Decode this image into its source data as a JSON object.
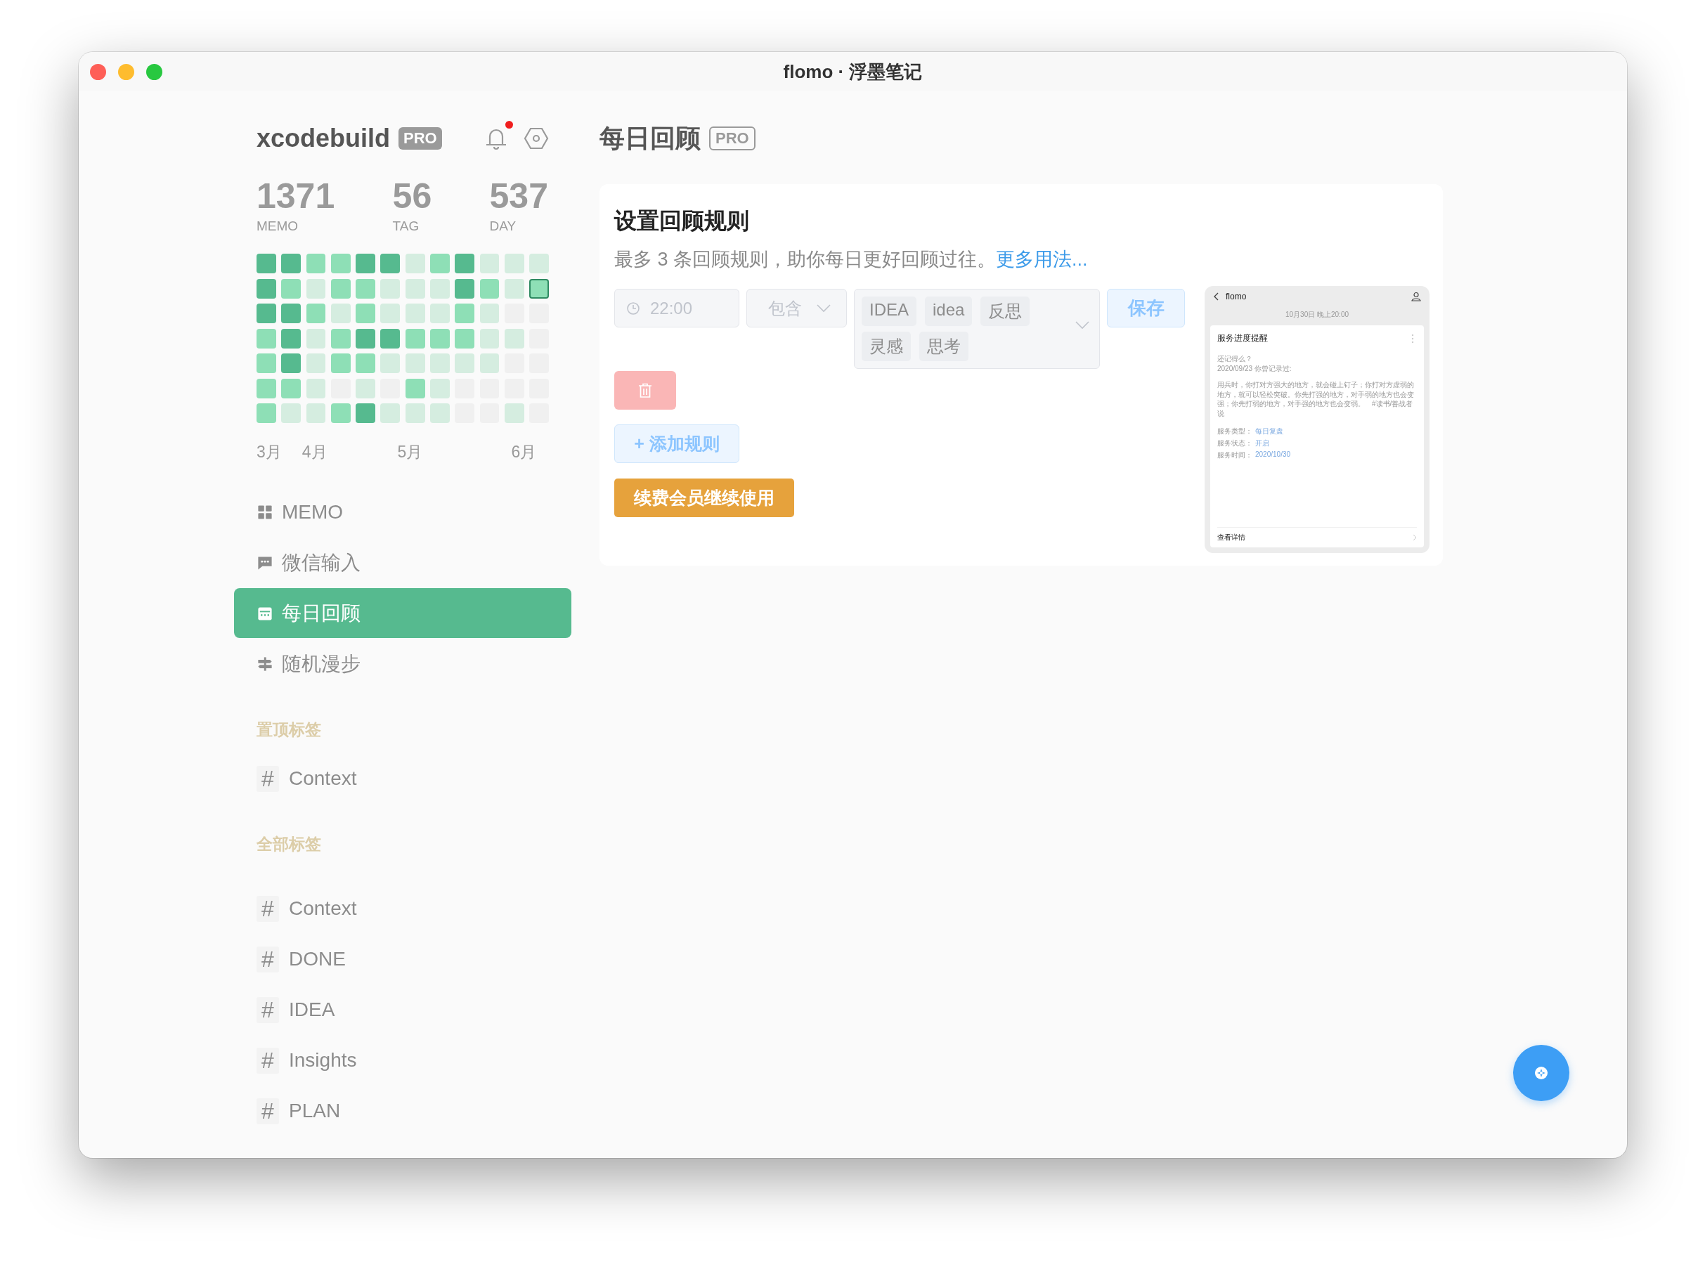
{
  "window": {
    "title": "flomo · 浮墨笔记"
  },
  "sidebar": {
    "user": {
      "name": "xcodebuild",
      "badge": "PRO",
      "unread": true
    },
    "stats": [
      {
        "value": "1371",
        "label": "MEMO"
      },
      {
        "value": "56",
        "label": "TAG"
      },
      {
        "value": "537",
        "label": "DAY"
      }
    ],
    "heatmap": {
      "rows": [
        {
          "cells": [
            {
              "color": "#56ba8f",
              "outlined": false
            },
            {
              "color": "#56ba8f",
              "outlined": false
            },
            {
              "color": "#8edfb6",
              "outlined": false
            },
            {
              "color": "#8edfb6",
              "outlined": false
            },
            {
              "color": "#56ba8f",
              "outlined": false
            },
            {
              "color": "#56ba8f",
              "outlined": false
            },
            {
              "color": "#d5ede0",
              "outlined": false
            },
            {
              "color": "#8edfb6",
              "outlined": false
            },
            {
              "color": "#56ba8f",
              "outlined": false
            },
            {
              "color": "#d5ede0",
              "outlined": false
            },
            {
              "color": "#d5ede0",
              "outlined": false
            },
            {
              "color": "#d5ede0",
              "outlined": false
            }
          ]
        },
        {
          "cells": [
            {
              "color": "#56ba8f",
              "outlined": false
            },
            {
              "color": "#8edfb6",
              "outlined": false
            },
            {
              "color": "#d5ede0",
              "outlined": false
            },
            {
              "color": "#8edfb6",
              "outlined": false
            },
            {
              "color": "#8edfb6",
              "outlined": false
            },
            {
              "color": "#d5ede0",
              "outlined": false
            },
            {
              "color": "#d5ede0",
              "outlined": false
            },
            {
              "color": "#d5ede0",
              "outlined": false
            },
            {
              "color": "#56ba8f",
              "outlined": false
            },
            {
              "color": "#8edfb6",
              "outlined": false
            },
            {
              "color": "#d5ede0",
              "outlined": false
            },
            {
              "color": "#8edfb6",
              "outlined": true
            }
          ]
        },
        {
          "cells": [
            {
              "color": "#56ba8f",
              "outlined": false
            },
            {
              "color": "#56ba8f",
              "outlined": false
            },
            {
              "color": "#8edfb6",
              "outlined": false
            },
            {
              "color": "#d5ede0",
              "outlined": false
            },
            {
              "color": "#8edfb6",
              "outlined": false
            },
            {
              "color": "#d5ede0",
              "outlined": false
            },
            {
              "color": "#d5ede0",
              "outlined": false
            },
            {
              "color": "#d5ede0",
              "outlined": false
            },
            {
              "color": "#8edfb6",
              "outlined": false
            },
            {
              "color": "#d5ede0",
              "outlined": false
            },
            {
              "color": "#f0f0f0",
              "outlined": false
            },
            {
              "color": "#f0f0f0",
              "outlined": false
            }
          ]
        },
        {
          "cells": [
            {
              "color": "#8edfb6",
              "outlined": false
            },
            {
              "color": "#56ba8f",
              "outlined": false
            },
            {
              "color": "#d5ede0",
              "outlined": false
            },
            {
              "color": "#8edfb6",
              "outlined": false
            },
            {
              "color": "#56ba8f",
              "outlined": false
            },
            {
              "color": "#56ba8f",
              "outlined": false
            },
            {
              "color": "#8edfb6",
              "outlined": false
            },
            {
              "color": "#8edfb6",
              "outlined": false
            },
            {
              "color": "#8edfb6",
              "outlined": false
            },
            {
              "color": "#d5ede0",
              "outlined": false
            },
            {
              "color": "#d5ede0",
              "outlined": false
            },
            {
              "color": "#f0f0f0",
              "outlined": false
            }
          ]
        },
        {
          "cells": [
            {
              "color": "#8edfb6",
              "outlined": false
            },
            {
              "color": "#56ba8f",
              "outlined": false
            },
            {
              "color": "#d5ede0",
              "outlined": false
            },
            {
              "color": "#8edfb6",
              "outlined": false
            },
            {
              "color": "#8edfb6",
              "outlined": false
            },
            {
              "color": "#d5ede0",
              "outlined": false
            },
            {
              "color": "#d5ede0",
              "outlined": false
            },
            {
              "color": "#d5ede0",
              "outlined": false
            },
            {
              "color": "#d5ede0",
              "outlined": false
            },
            {
              "color": "#d5ede0",
              "outlined": false
            },
            {
              "color": "#f0f0f0",
              "outlined": false
            },
            {
              "color": "#f0f0f0",
              "outlined": false
            }
          ]
        },
        {
          "cells": [
            {
              "color": "#8edfb6",
              "outlined": false
            },
            {
              "color": "#8edfb6",
              "outlined": false
            },
            {
              "color": "#d5ede0",
              "outlined": false
            },
            {
              "color": "#f0f0f0",
              "outlined": false
            },
            {
              "color": "#d5ede0",
              "outlined": false
            },
            {
              "color": "#f0f0f0",
              "outlined": false
            },
            {
              "color": "#8edfb6",
              "outlined": false
            },
            {
              "color": "#d5ede0",
              "outlined": false
            },
            {
              "color": "#f0f0f0",
              "outlined": false
            },
            {
              "color": "#f0f0f0",
              "outlined": false
            },
            {
              "color": "#f0f0f0",
              "outlined": false
            },
            {
              "color": "#f0f0f0",
              "outlined": false
            }
          ]
        },
        {
          "cells": [
            {
              "color": "#8edfb6",
              "outlined": false
            },
            {
              "color": "#d5ede0",
              "outlined": false
            },
            {
              "color": "#d5ede0",
              "outlined": false
            },
            {
              "color": "#8edfb6",
              "outlined": false
            },
            {
              "color": "#56ba8f",
              "outlined": false
            },
            {
              "color": "#d5ede0",
              "outlined": false
            },
            {
              "color": "#d5ede0",
              "outlined": false
            },
            {
              "color": "#d5ede0",
              "outlined": false
            },
            {
              "color": "#f0f0f0",
              "outlined": false
            },
            {
              "color": "#f0f0f0",
              "outlined": false
            },
            {
              "color": "#d5ede0",
              "outlined": false
            },
            {
              "color": "#f0f0f0",
              "outlined": false
            }
          ]
        }
      ],
      "months": [
        "3月",
        "4月",
        "5月",
        "6月"
      ]
    },
    "nav": [
      {
        "kind": "grid",
        "label": "MEMO",
        "selected": false
      },
      {
        "kind": "chat",
        "label": "微信输入",
        "selected": false
      },
      {
        "kind": "calendar",
        "label": "每日回顾",
        "selected": true
      },
      {
        "kind": "signpost",
        "label": "随机漫步",
        "selected": false
      }
    ],
    "pinned_tags": {
      "heading": "置顶标签",
      "items": [
        {
          "symbol": "#",
          "label": "Context"
        }
      ]
    },
    "all_tags": {
      "heading": "全部标签",
      "items": [
        {
          "symbol": "#",
          "label": "Context"
        },
        {
          "symbol": "#",
          "label": "DONE"
        },
        {
          "symbol": "#",
          "label": "IDEA"
        },
        {
          "symbol": "#",
          "label": "Insights"
        },
        {
          "symbol": "#",
          "label": "PLAN"
        }
      ]
    }
  },
  "main": {
    "title": "每日回顾",
    "badge": "PRO",
    "card": {
      "title": "设置回顾规则",
      "subtitle": "最多 3 条回顾规则，助你每日更好回顾过往。",
      "link": "更多用法...",
      "rule": {
        "disabled": true,
        "time": "22:00",
        "condition": "包含",
        "tags": [
          "IDEA",
          "idea",
          "反思",
          "灵感",
          "思考"
        ],
        "save": "保存"
      },
      "add_button": "+ 添加规则",
      "renew_button": "续费会员继续使用",
      "preview": {
        "app": "flomo",
        "time": "10月30日 晚上20:00",
        "title": "服务进度提醒",
        "intro": [
          "还记得么？",
          "2020/09/23 你曾记录过:"
        ],
        "body": "用兵时，你打对方强大的地方，就会碰上钉子；你打对方虚弱的地方，就可以轻松突破。你先打强的地方，对手弱的地方也会变强；你先打弱的地方，对手强的地方也会变弱。　#读书/善战者说",
        "fields": [
          {
            "label": "服务类型：",
            "value": "每日复盘"
          },
          {
            "label": "服务状态：",
            "value": "开启"
          },
          {
            "label": "服务时间：",
            "value": "2020/10/30"
          }
        ],
        "footer": "查看详情"
      }
    }
  }
}
